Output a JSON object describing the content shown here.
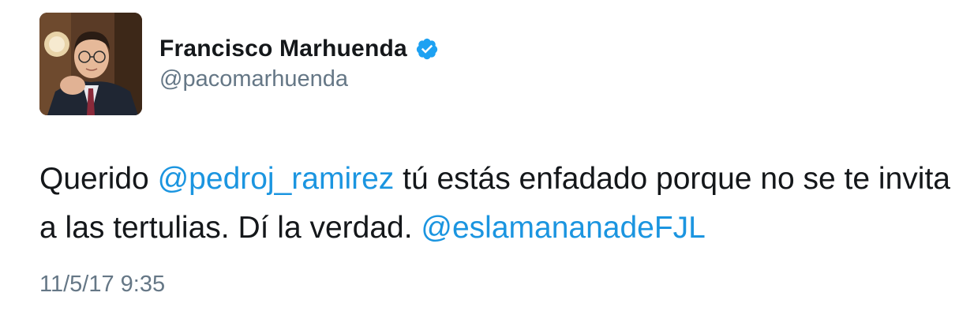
{
  "user": {
    "display_name": "Francisco Marhuenda",
    "handle": "@pacomarhuenda",
    "verified_icon": "verified-badge-icon",
    "verified_color": "#1da1f2"
  },
  "tweet": {
    "text_part1": "Querido ",
    "mention1": "@pedroj_ramirez",
    "text_part2": " tú estás enfadado porque no se te invita a las tertulias. Dí la verdad. ",
    "mention2": "@eslamananadeFJL",
    "timestamp": "11/5/17 9:35"
  },
  "colors": {
    "text": "#14171a",
    "secondary": "#657786",
    "link": "#1b95e0"
  }
}
